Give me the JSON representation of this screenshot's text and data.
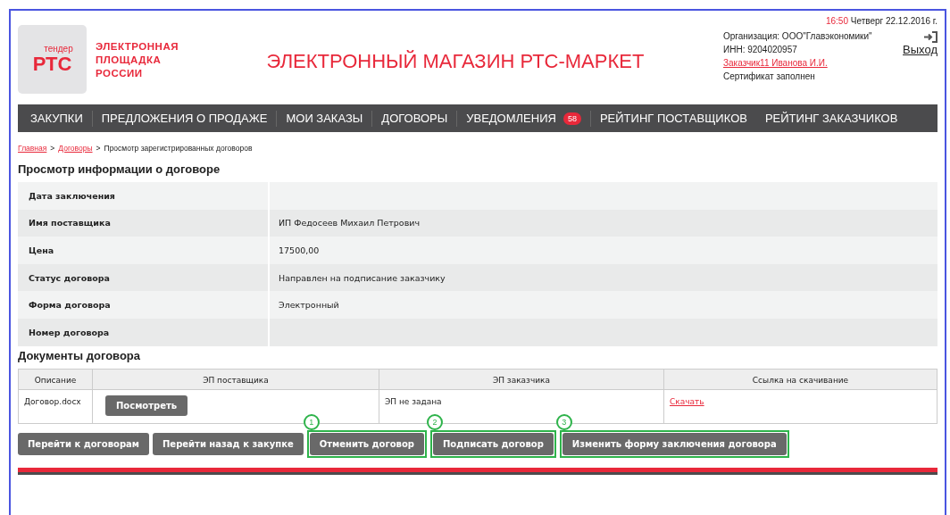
{
  "logo": {
    "small": "тендер",
    "big": "РТС"
  },
  "platform_name": [
    "ЭЛЕКТРОННАЯ",
    "ПЛОЩАДКА",
    "РОССИИ"
  ],
  "site_title": "ЭЛЕКТРОННЫЙ МАГАЗИН РТС-МАРКЕТ",
  "clock": {
    "time": "16:50",
    "date": "Четверг 22.12.2016 г."
  },
  "user": {
    "organization": "Организация: ООО\"Главэкономики\"",
    "inn": "ИНН: 9204020957",
    "name": "Заказчик11 Иванова И.И.",
    "certificate": "Сертификат заполнен"
  },
  "logout": "Выход",
  "nav": [
    {
      "label": "ЗАКУПКИ"
    },
    {
      "label": "ПРЕДЛОЖЕНИЯ О ПРОДАЖЕ"
    },
    {
      "label": "МОИ ЗАКАЗЫ"
    },
    {
      "label": "ДОГОВОРЫ"
    },
    {
      "label": "УВЕДОМЛЕНИЯ",
      "badge": "58"
    },
    {
      "label": "РЕЙТИНГ ПОСТАВЩИКОВ"
    },
    {
      "label": "РЕЙТИНГ ЗАКАЗЧИКОВ"
    }
  ],
  "breadcrumb_separator": ">",
  "breadcrumb": [
    {
      "label": "Главная",
      "kind": "link"
    },
    {
      "label": "Договоры",
      "kind": "link"
    },
    {
      "label": "Просмотр зарегистрированных договоров",
      "kind": "text"
    }
  ],
  "info_title": "Просмотр информации о договоре",
  "info_rows": [
    {
      "label": "Дата заключения"
    },
    {
      "label": "Имя поставщика",
      "value": "ИП Федосеев Михаил Петрович"
    },
    {
      "label": "Цена",
      "value": "17500,00"
    },
    {
      "label": "Статус договора",
      "value": "Направлен на подписание заказчику"
    },
    {
      "label": "Форма договора",
      "value": "Электронный"
    },
    {
      "label": "Номер договора"
    }
  ],
  "documents_title": "Документы договора",
  "documents_table": {
    "columns": [
      "Описание",
      "ЭП поставщика",
      "ЭП заказчика",
      "Ссылка на скачивание"
    ],
    "rows": [
      {
        "description": "Договор.docx",
        "supplier_button": "Посмотреть",
        "customer_signature": "ЭП не задана",
        "download": "Скачать"
      }
    ]
  },
  "actions": [
    {
      "label": "Перейти к договорам"
    },
    {
      "label": "Перейти назад к закупке"
    },
    {
      "label": "Отменить договор",
      "callout": "1"
    },
    {
      "label": "Подписать договор",
      "callout": "2"
    },
    {
      "label": "Изменить форму заключения договора",
      "callout": "3"
    }
  ]
}
